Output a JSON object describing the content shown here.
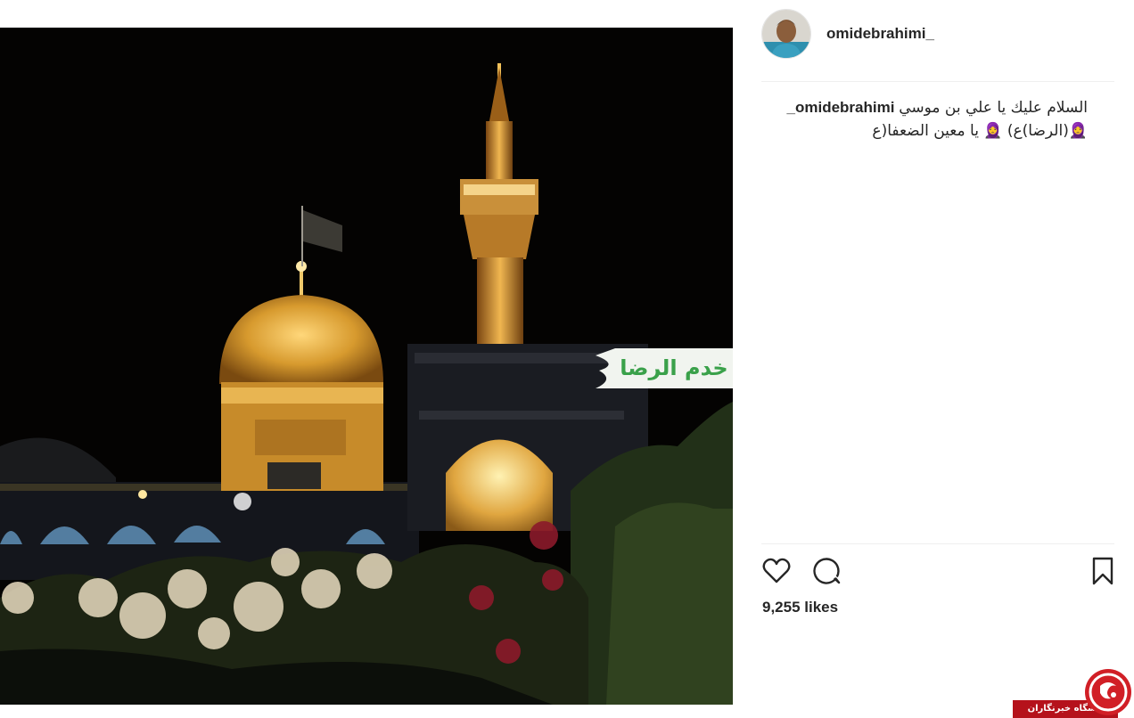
{
  "post": {
    "username": "omidebrahimi_",
    "photo_banner_text": "خدم الرضا",
    "caption": {
      "username": "omidebrahimi_",
      "line1": "السلام عليك يا علي بن موسي",
      "line2": "🧕(الرضا)ع) 🧕 يا معين الضعفا(ع"
    },
    "likes": "9,255 likes"
  },
  "icons": {
    "like": "heart-icon",
    "comment": "comment-icon",
    "save": "bookmark-icon"
  },
  "watermark": {
    "text": "باشگاه خبرنگاران"
  },
  "colors": {
    "text": "#262626",
    "divider": "#efefef",
    "watermark_red": "#b5121b",
    "dome_gold": "#d9a13b"
  }
}
